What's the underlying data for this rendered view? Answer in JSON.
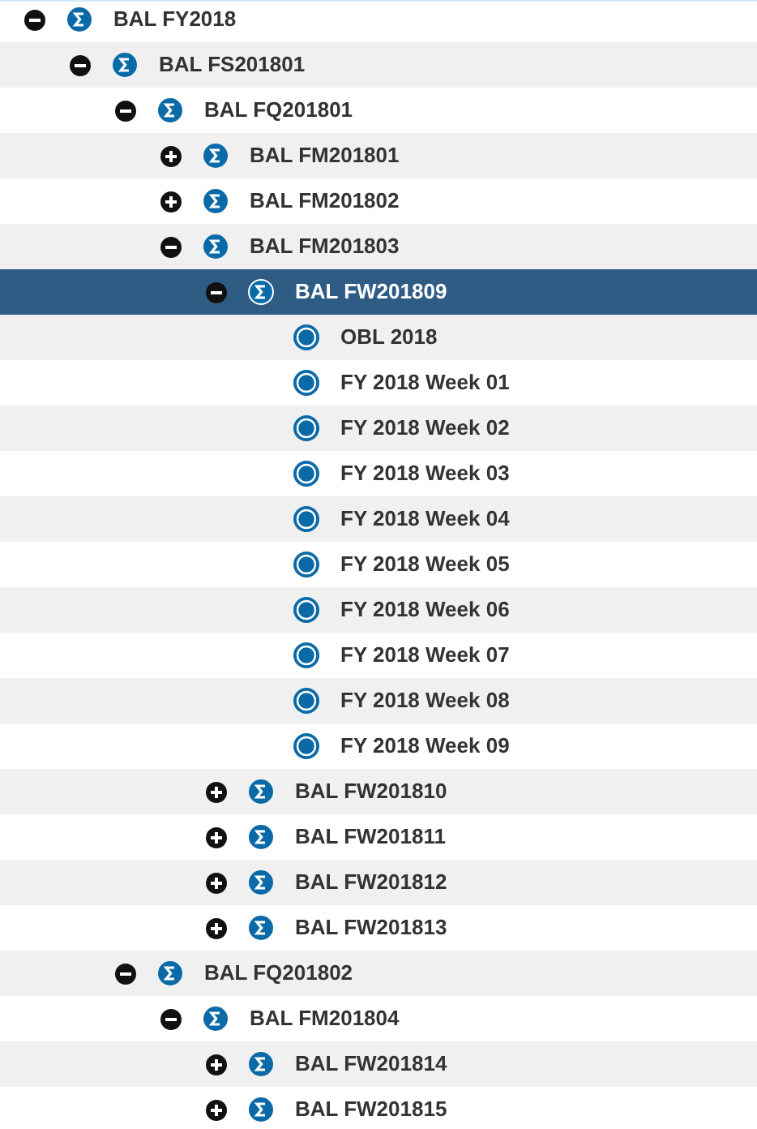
{
  "tree": [
    {
      "label": "BAL FY2018",
      "kind": "sum",
      "expanded": true,
      "selected": false,
      "children": [
        {
          "label": "BAL FS201801",
          "kind": "sum",
          "expanded": true,
          "selected": false,
          "children": [
            {
              "label": "BAL FQ201801",
              "kind": "sum",
              "expanded": true,
              "selected": false,
              "children": [
                {
                  "label": "BAL FM201801",
                  "kind": "sum",
                  "expanded": false,
                  "selected": false
                },
                {
                  "label": "BAL FM201802",
                  "kind": "sum",
                  "expanded": false,
                  "selected": false
                },
                {
                  "label": "BAL FM201803",
                  "kind": "sum",
                  "expanded": true,
                  "selected": false,
                  "children": [
                    {
                      "label": "BAL FW201809",
                      "kind": "sum",
                      "expanded": true,
                      "selected": true,
                      "children": [
                        {
                          "label": "OBL 2018",
                          "kind": "leaf",
                          "selected": false
                        },
                        {
                          "label": "FY 2018 Week 01",
                          "kind": "leaf",
                          "selected": false
                        },
                        {
                          "label": "FY 2018 Week 02",
                          "kind": "leaf",
                          "selected": false
                        },
                        {
                          "label": "FY 2018 Week 03",
                          "kind": "leaf",
                          "selected": false
                        },
                        {
                          "label": "FY 2018 Week 04",
                          "kind": "leaf",
                          "selected": false
                        },
                        {
                          "label": "FY 2018 Week 05",
                          "kind": "leaf",
                          "selected": false
                        },
                        {
                          "label": "FY 2018 Week 06",
                          "kind": "leaf",
                          "selected": false
                        },
                        {
                          "label": "FY 2018 Week 07",
                          "kind": "leaf",
                          "selected": false
                        },
                        {
                          "label": "FY 2018 Week 08",
                          "kind": "leaf",
                          "selected": false
                        },
                        {
                          "label": "FY 2018 Week 09",
                          "kind": "leaf",
                          "selected": false
                        }
                      ]
                    },
                    {
                      "label": "BAL FW201810",
                      "kind": "sum",
                      "expanded": false,
                      "selected": false
                    },
                    {
                      "label": "BAL FW201811",
                      "kind": "sum",
                      "expanded": false,
                      "selected": false
                    },
                    {
                      "label": "BAL FW201812",
                      "kind": "sum",
                      "expanded": false,
                      "selected": false
                    },
                    {
                      "label": "BAL FW201813",
                      "kind": "sum",
                      "expanded": false,
                      "selected": false
                    }
                  ]
                }
              ]
            },
            {
              "label": "BAL FQ201802",
              "kind": "sum",
              "expanded": true,
              "selected": false,
              "children": [
                {
                  "label": "BAL FM201804",
                  "kind": "sum",
                  "expanded": true,
                  "selected": false,
                  "children": [
                    {
                      "label": "BAL FW201814",
                      "kind": "sum",
                      "expanded": false,
                      "selected": false
                    },
                    {
                      "label": "BAL FW201815",
                      "kind": "sum",
                      "expanded": false,
                      "selected": false
                    }
                  ]
                }
              ]
            }
          ]
        }
      ]
    }
  ]
}
